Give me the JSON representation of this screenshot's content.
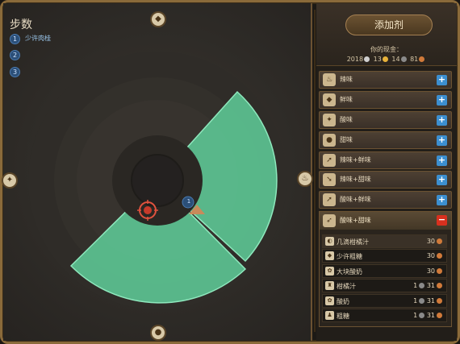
{
  "steps": {
    "title": "步数",
    "items": [
      {
        "num": "1",
        "label": "少许肉桂"
      },
      {
        "num": "2",
        "label": ""
      },
      {
        "num": "3",
        "label": ""
      }
    ]
  },
  "board": {
    "marker_number": "1"
  },
  "panel": {
    "add_button": "添加剂",
    "cash_label": "你的现金：",
    "cash": {
      "a": "2018",
      "b": "13",
      "c": "14",
      "d": "81"
    }
  },
  "flavors": [
    {
      "label": "辣味",
      "icon": "pepper-icon",
      "glyph": "♨"
    },
    {
      "label": "鲜味",
      "icon": "meat-icon",
      "glyph": "◆"
    },
    {
      "label": "酸味",
      "icon": "sour-icon",
      "glyph": "✦"
    },
    {
      "label": "甜味",
      "icon": "sweet-icon",
      "glyph": "●"
    },
    {
      "label": "辣味+鲜味",
      "icon": "arrow-combo-icon",
      "glyph": "➚"
    },
    {
      "label": "辣味+甜味",
      "icon": "arrow-combo-icon",
      "glyph": "➘"
    },
    {
      "label": "酸味+鲜味",
      "icon": "arrow-combo-icon",
      "glyph": "➚"
    }
  ],
  "expanded": {
    "label": "酸味+甜味",
    "ingredients": [
      {
        "name": "几滴柑橘汁",
        "price": "30"
      },
      {
        "name": "少许粗糖",
        "price": "30"
      },
      {
        "name": "大块酸奶",
        "price": "30"
      },
      {
        "name": "柑橘汁",
        "qty": "1",
        "price": "31"
      },
      {
        "name": "酸奶",
        "qty": "1",
        "price": "31"
      },
      {
        "name": "粗糖",
        "qty": "1",
        "price": "31"
      }
    ]
  },
  "colors": {
    "accent_green": "#5fcf9a",
    "plus_blue": "#3c8fd0",
    "minus_red": "#d8301e",
    "frame_gold": "#8a6a3a"
  }
}
